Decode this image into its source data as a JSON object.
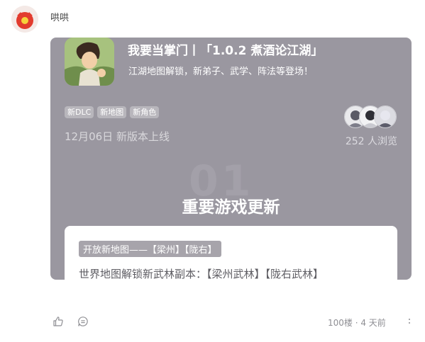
{
  "post": {
    "username": "哄哄",
    "meta": "100楼 · 4 天前"
  },
  "card": {
    "title": "我要当掌门丨「1.0.2 煮酒论江湖」",
    "subtitle": "江湖地图解锁，新弟子、武学、阵法等登场！",
    "tags": [
      "新DLC",
      "新地图",
      "新角色"
    ],
    "release": "12月06日 新版本上线",
    "view_count": "252 人浏览",
    "watermark": "01",
    "section_title": "重要游戏更新",
    "inner_tag": "开放新地图——【梁州】【陇右】",
    "inner_text": "世界地图解锁新武林副本：【梁州武林】【陇右武林】"
  },
  "colors": {
    "card_bg": "#9a97a0",
    "tag_bg": "#b8b6bc",
    "inner_tag_bg": "#a7a4ab",
    "meta_text": "#8e8e93"
  },
  "icons": {
    "like": "thumbs-up-icon",
    "comment": "comment-icon",
    "more": "more-vertical-icon"
  }
}
